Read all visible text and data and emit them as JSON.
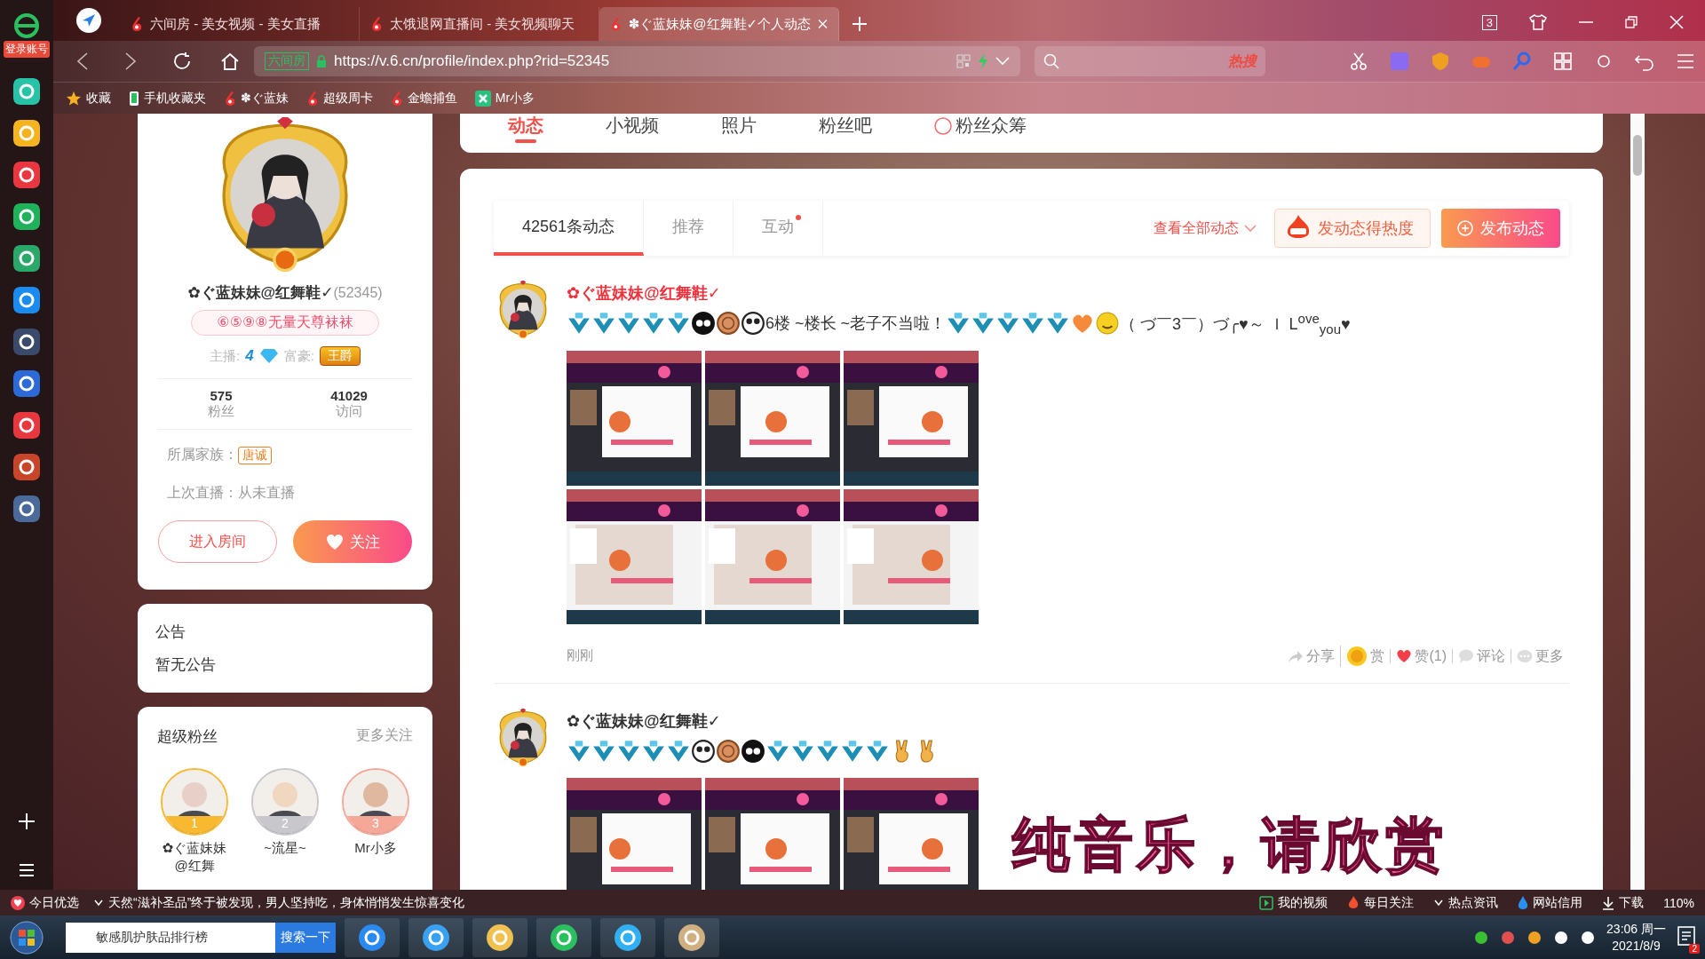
{
  "browser": {
    "login_label": "登录账号",
    "tabs": [
      {
        "title": "六间房 - 美女视频 - 美女直播",
        "selected": false
      },
      {
        "title": "太饿退网直播间 - 美女视频聊天",
        "selected": false
      },
      {
        "title": "✽ぐ蓝妹妹@红舞鞋✓个人动态",
        "selected": true
      }
    ],
    "tab_count": "3",
    "site_badge": "六间房",
    "url": "https://v.6.cn/profile/index.php?rid=52345",
    "search_hot": "热搜",
    "bookmarks": [
      {
        "kind": "star",
        "label": "收藏"
      },
      {
        "kind": "phone",
        "label": "手机收藏夹"
      },
      {
        "kind": "six",
        "label": "✽ぐ蓝妹"
      },
      {
        "kind": "six",
        "label": "超级周卡"
      },
      {
        "kind": "six",
        "label": "金蟾捕鱼"
      },
      {
        "kind": "app",
        "label": "Mr小多"
      }
    ]
  },
  "page": {
    "nav": [
      {
        "label": "动态",
        "selected": true
      },
      {
        "label": "小视频",
        "selected": false
      },
      {
        "label": "照片",
        "selected": false
      },
      {
        "label": "粉丝吧",
        "selected": false
      },
      {
        "label": "粉丝众筹",
        "selected": false
      }
    ],
    "profile": {
      "name": "✿ぐ蓝妹妹@红舞鞋✓",
      "id": "(52345)",
      "tag": "⑥⑤⑨⑧无量天尊袜袜",
      "anchor_label": "主播:",
      "anchor_level": "4",
      "rich_label": "富豪:",
      "rich_badge": "王爵",
      "stats": [
        {
          "value": "575",
          "label": "粉丝"
        },
        {
          "value": "41029",
          "label": "访问"
        }
      ],
      "family_label": "所属家族：",
      "family": "唐诚",
      "last_live": "上次直播：从未直播",
      "enter_button": "进入房间",
      "follow_button": "关注"
    },
    "notice": {
      "title": "公告",
      "text": "暂无公告"
    },
    "fans": {
      "title": "超级粉丝",
      "more": "更多关注",
      "items": [
        {
          "rank": "1",
          "name": "✿ぐ蓝妹妹@红舞",
          "color": "#f8b830"
        },
        {
          "rank": "2",
          "name": "~流星~",
          "color": "#c8c8cc"
        },
        {
          "rank": "3",
          "name": "Mr小多",
          "color": "#f6a898"
        }
      ]
    },
    "feed": {
      "tabs": [
        {
          "label": "42561条动态",
          "selected": true,
          "dot": false
        },
        {
          "label": "推荐",
          "selected": false,
          "dot": false
        },
        {
          "label": "互动",
          "selected": false,
          "dot": true
        }
      ],
      "view_all": "查看全部动态",
      "hot_button": "发动态得热度",
      "publish_button": "发布动态",
      "posts": [
        {
          "author": "✿ぐ蓝妹妹@红舞鞋✓",
          "highlighted": true,
          "content": [
            {
              "kind": "five"
            },
            {
              "kind": "five"
            },
            {
              "kind": "five"
            },
            {
              "kind": "five"
            },
            {
              "kind": "five"
            },
            {
              "kind": "cool"
            },
            {
              "kind": "coin"
            },
            {
              "kind": "panda"
            },
            {
              "kind": "text",
              "text": "6楼 ~楼长 ~老子不当啦！"
            },
            {
              "kind": "five"
            },
            {
              "kind": "five"
            },
            {
              "kind": "five"
            },
            {
              "kind": "five"
            },
            {
              "kind": "five"
            },
            {
              "kind": "heart"
            },
            {
              "kind": "smile"
            },
            {
              "kind": "text",
              "text": "（ づ￣3￣）づ╭♥～ Ｉ L$^{ove}$$_{you}$♥"
            }
          ],
          "images": [
            {
              "kind": "picture"
            },
            {
              "kind": "picture"
            },
            {
              "kind": "picture"
            },
            {
              "kind": "picture"
            },
            {
              "kind": "picture"
            },
            {
              "kind": "picture"
            }
          ],
          "time": "刚刚",
          "actions": [
            {
              "kind": "share",
              "label": "分享"
            },
            {
              "kind": "reward",
              "label": "赏"
            },
            {
              "kind": "like",
              "label": "赞(1)"
            },
            {
              "kind": "comment",
              "label": "评论"
            },
            {
              "kind": "more",
              "label": "更多"
            }
          ]
        },
        {
          "author": "✿ぐ蓝妹妹@红舞鞋✓",
          "highlighted": false,
          "content": [
            {
              "kind": "five"
            },
            {
              "kind": "five"
            },
            {
              "kind": "five"
            },
            {
              "kind": "five"
            },
            {
              "kind": "five"
            },
            {
              "kind": "panda"
            },
            {
              "kind": "coin"
            },
            {
              "kind": "cool"
            },
            {
              "kind": "five"
            },
            {
              "kind": "five"
            },
            {
              "kind": "five"
            },
            {
              "kind": "five"
            },
            {
              "kind": "five"
            },
            {
              "kind": "victory"
            },
            {
              "kind": "victory"
            }
          ],
          "images": [
            {
              "kind": "picture"
            },
            {
              "kind": "picture"
            },
            {
              "kind": "picture"
            }
          ]
        }
      ]
    }
  },
  "lyrics_overlay": "纯音乐，请欣赏",
  "status_bar": {
    "left": [
      {
        "kind": "heart",
        "label": "今日优选"
      },
      {
        "kind": "news",
        "label": "天然“滋补圣品”终于被发现，男人坚持吃，身体悄悄发生惊喜变化"
      }
    ],
    "right": [
      {
        "kind": "video",
        "label": "我的视频"
      },
      {
        "kind": "fire",
        "label": "每日关注"
      },
      {
        "kind": "news",
        "label": "热点资讯"
      },
      {
        "kind": "drop",
        "label": "网站信用"
      },
      {
        "kind": "download",
        "label": "下载"
      }
    ],
    "zoom": "110%"
  },
  "taskbar": {
    "search_value": "敏感肌护肤品排行榜",
    "search_button": "搜索一下",
    "time": "23:06 周一",
    "date": "2021/8/9",
    "notifications": "2"
  }
}
